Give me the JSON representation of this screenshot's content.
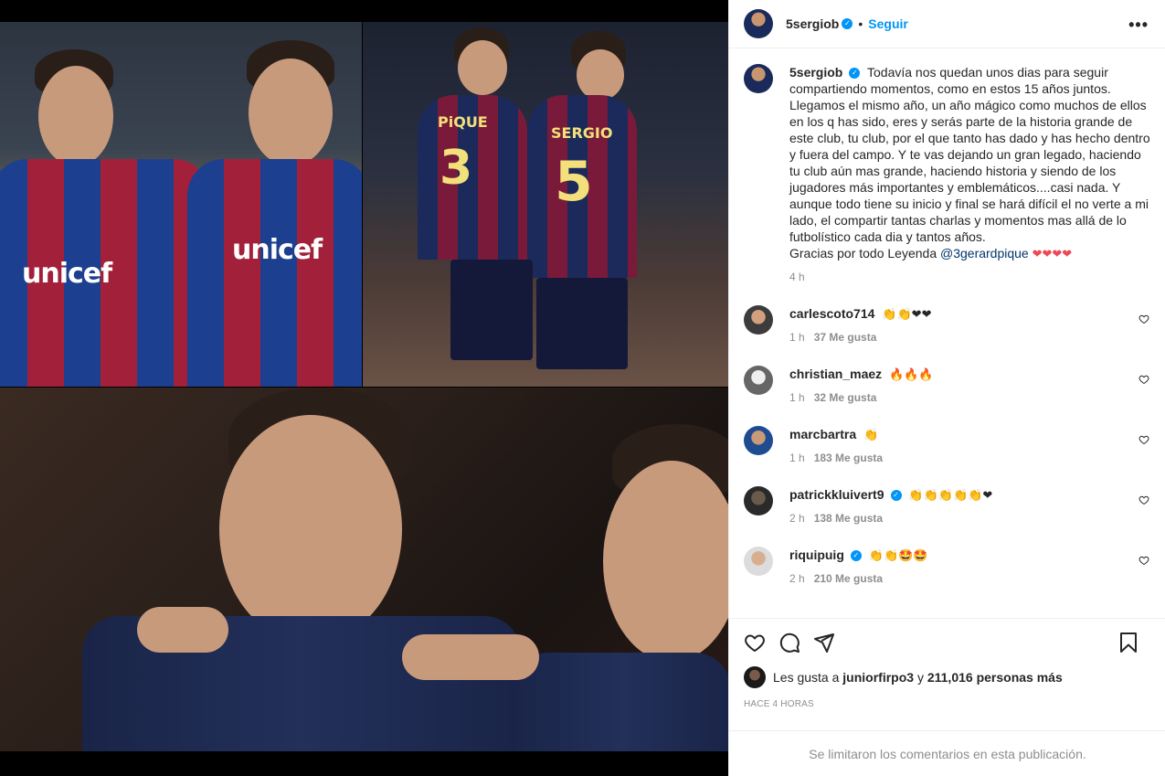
{
  "post": {
    "username": "5sergiob",
    "follow_label": "Seguir",
    "more_label": "•••",
    "caption_text": "Todavía nos quedan unos dias para seguir compartiendo momentos, como en estos 15 años juntos. Llegamos el mismo año, un año mágico como muchos de ellos en los q has sido, eres y serás parte de la historia grande de este club, tu club, por el que tanto has dado y has hecho dentro y fuera del campo. Y te vas dejando un gran legado, haciendo tu club aún mas grande, haciendo historia y siendo de los jugadores más importantes y emblemáticos....casi nada. Y aunque todo tiene su inicio y final se hará difícil el no verte a mi lado, el compartir tantas charlas y momentos mas allá de lo futbolístico cada dia y tantos años.",
    "caption_thanks": "Gracias por todo Leyenda",
    "caption_mention": "@3gerardpique",
    "caption_tail": "❤❤❤❤",
    "caption_time": "4 h"
  },
  "media": {
    "kit_text_1": "unicef",
    "kit_text_2": "unicef",
    "shirt_name": "SERGIO",
    "shirt_number_1": "3",
    "shirt_number_2": "5",
    "shirt_name_2": "PiQUE"
  },
  "comments": [
    {
      "username": "carlescoto714",
      "verified": false,
      "text": "👏👏❤❤",
      "time": "1 h",
      "likes": "37 Me gusta"
    },
    {
      "username": "christian_maez",
      "verified": false,
      "text": "🔥🔥🔥",
      "time": "1 h",
      "likes": "32 Me gusta"
    },
    {
      "username": "marcbartra",
      "verified": false,
      "text": "👏",
      "time": "1 h",
      "likes": "183 Me gusta"
    },
    {
      "username": "patrickkluivert9",
      "verified": true,
      "text": "👏👏👏👏👏❤",
      "time": "2 h",
      "likes": "138 Me gusta"
    },
    {
      "username": "riquipuig",
      "verified": true,
      "text": "👏👏🤩🤩",
      "time": "2 h",
      "likes": "210 Me gusta"
    }
  ],
  "likes": {
    "prefix": "Les gusta a",
    "user": "juniorfirpo3",
    "connector": "y",
    "count": "211,016 personas más"
  },
  "time_ago": "HACE 4 HORAS",
  "footer_text": "Se limitaron los comentarios en esta publicación.",
  "icons": {
    "like": "heart-icon",
    "comment": "comment-icon",
    "share": "paper-plane-icon",
    "save": "bookmark-icon",
    "more": "more-options-icon",
    "verified": "verified-badge-icon"
  },
  "colors": {
    "accent": "#0095f6",
    "mention": "#00376b",
    "muted": "#8e8e8e",
    "heart_red": "#ed4956"
  }
}
